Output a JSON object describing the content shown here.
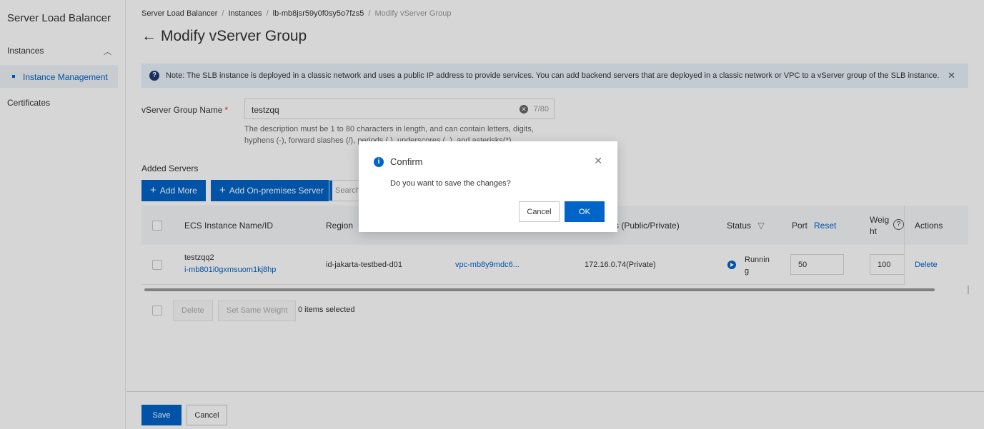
{
  "sidebar": {
    "title": "Server Load Balancer",
    "group_label": "Instances",
    "active_item": "Instance Management",
    "certificates": "Certificates"
  },
  "breadcrumb": [
    "Server Load Balancer",
    "Instances",
    "lb-mb8jsr59y0f0sy5o7fzs5",
    "Modify vServer Group"
  ],
  "page": {
    "title": "Modify vServer Group",
    "note": "Note: The SLB instance is deployed in a classic network and uses a public IP address to provide services. You can add backend servers that are deployed in a classic network or VPC to a vServer group of the SLB instance."
  },
  "form": {
    "name_label": "vServer Group Name",
    "required_mark": "*",
    "name_value": "testzqq",
    "char_count": "7/80",
    "hint": "The description must be 1 to 80 characters in length, and can contain letters, digits, hyphens (-), forward slashes (/), periods (.), underscores (_), and asterisks(*)."
  },
  "servers": {
    "section_label": "Added Servers",
    "add_more": "Add More",
    "add_onprem": "Add On-premises Server",
    "search_placeholder": "Search",
    "columns": {
      "name": "ECS Instance Name/ID",
      "region": "Region",
      "ip": "s (Public/Private)",
      "status": "Status",
      "port": "Port",
      "port_reset": "Reset",
      "weight_1": "Weig",
      "weight_2": "ht",
      "actions": "Actions"
    },
    "rows": [
      {
        "name": "testzqq2",
        "id": "i-mb801i0gxmsuom1kj8hp",
        "region": "id-jakarta-testbed-d01",
        "vpc": "vpc-mb8y9mdc6...",
        "ip": "172.16.0.74(Private)",
        "status_1": "Runnin",
        "status_2": "g",
        "port": "50",
        "weight": "100",
        "action": "Delete"
      }
    ],
    "bulk_delete": "Delete",
    "bulk_weight": "Set Same Weight",
    "selected": "0 items selected"
  },
  "footer": {
    "save": "Save",
    "cancel": "Cancel"
  },
  "dialog": {
    "title": "Confirm",
    "body": "Do you want to save the changes?",
    "cancel": "Cancel",
    "ok": "OK"
  }
}
